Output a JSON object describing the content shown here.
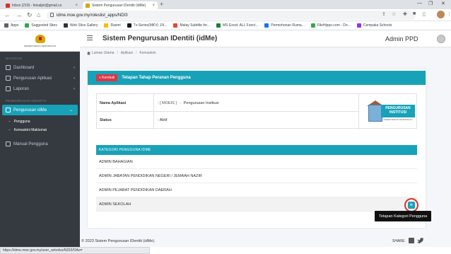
{
  "browser": {
    "tabs": [
      {
        "label": "Inbox (219) - feisaljet@gmail.co",
        "favicon_color": "#d93025"
      },
      {
        "label": "Sistem Pengurusan IDentiti (idMe)",
        "favicon_color": "#d9a400"
      }
    ],
    "url": "idme.moe.gov.my/roleslist_apps/NDI3",
    "bookmarks": [
      {
        "label": "Apps",
        "color": "#5f6368"
      },
      {
        "label": "Suggested Sites",
        "color": "#34a853"
      },
      {
        "label": "Web Slice Gallery",
        "color": "#333333"
      },
      {
        "label": "Rasmi",
        "color": "#fbbc04"
      },
      {
        "label": "Tv-Series(MKV) ,Fil...",
        "color": "#1a1a1a"
      },
      {
        "label": "Malay Subtitle for...",
        "color": "#ea4335"
      },
      {
        "label": "MS Excel: ALL Funct...",
        "color": "#188038"
      },
      {
        "label": "Permohonan Ruma...",
        "color": "#1a73e8"
      },
      {
        "label": "FileHippo.com - Do...",
        "color": "#34a853"
      },
      {
        "label": "Cempaka Schools",
        "color": "#9334e6"
      }
    ],
    "status_url": "https://idme.moe.gov.my/user_setroles/NDI3/OAo="
  },
  "sidebar": {
    "logo_text": "KEMENTERIAN PENDIDIKAN",
    "heading_nav": "NAVIGASI",
    "heading_admin": "PENGURUSAN IDENTITI",
    "items": [
      {
        "label": "Dashboard",
        "chevron": "‹"
      },
      {
        "label": "Pengurusan Aplikasi",
        "chevron": "‹"
      },
      {
        "label": "Laporan",
        "chevron": "‹"
      },
      {
        "label": "Pengurusan idMe",
        "chevron": "⌄"
      },
      {
        "label": "Manual Pengguna",
        "chevron": ""
      }
    ],
    "subitems": [
      "Pengguna",
      "Kemaskini Maklumat"
    ]
  },
  "header": {
    "title": "Sistem Pengurusan IDentiti (idMe)",
    "user": "Admin PPD"
  },
  "breadcrumb": [
    "Laman Utama",
    "Aplikasi",
    "Kemaskini"
  ],
  "card": {
    "back_label": "« Kembali",
    "title": "Tetapan Tahap Peranan Pengguna",
    "app_label": "Nama Aplikasi",
    "app_tag": ": [ MOEIS ]",
    "app_value": "Pengurusan Institusi",
    "status_label": "Status",
    "status_value": ": Aktif",
    "banner_text": "PENGURUSAN INSTITUSI",
    "banner_sub": "KEMENTERIAN PENDIDIKAN"
  },
  "categories": {
    "heading": "KATEGORI PENGGUNA IDME",
    "rows": [
      "ADMIN BAHAGIAN",
      "ADMIN JABATAN PENDIDIKAN NEGERI / JEMAAH NAZIR",
      "ADMIN PEJABAT PENDIDIKAN DAERAH",
      "ADMIN SEKOLAH"
    ],
    "tooltip": "Tetapan Kategori Pengguna"
  },
  "footer": {
    "copyright": "© 2023 Sistem Pengurusan IDentiti (idMe).",
    "share": "SHARE:"
  }
}
